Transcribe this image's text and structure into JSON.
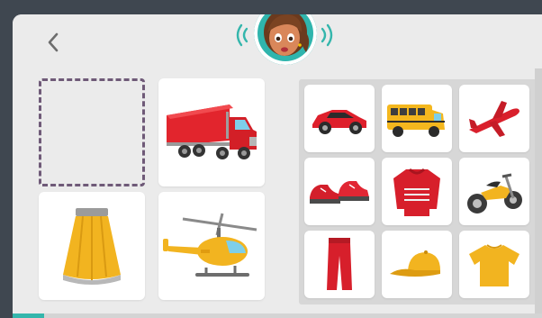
{
  "app": {
    "accent_color": "#34b6ac",
    "frame_color": "#3f4750",
    "dropzone_border_color": "#6f5a78"
  },
  "header": {
    "back_icon": "chevron-left-icon",
    "speaker_avatar_icon": "girl-avatar-icon",
    "sound_waves_icon": "sound-waves-icon"
  },
  "answer_area": {
    "dropzone_icon": "empty-dashed-slot",
    "options": [
      {
        "id": "truck",
        "icon": "red-semi-truck-icon"
      },
      {
        "id": "skirt",
        "icon": "yellow-skirt-icon"
      },
      {
        "id": "helicopter",
        "icon": "yellow-helicopter-icon"
      }
    ]
  },
  "choice_grid": {
    "items": [
      {
        "id": "car",
        "icon": "red-car-icon"
      },
      {
        "id": "bus",
        "icon": "yellow-school-bus-icon"
      },
      {
        "id": "airplane",
        "icon": "red-airplane-icon"
      },
      {
        "id": "shoes",
        "icon": "red-shoes-icon"
      },
      {
        "id": "sweater",
        "icon": "red-sweater-icon"
      },
      {
        "id": "motorcycle",
        "icon": "yellow-motorcycle-icon"
      },
      {
        "id": "pants",
        "icon": "red-pants-icon"
      },
      {
        "id": "cap",
        "icon": "yellow-cap-icon"
      },
      {
        "id": "tshirt",
        "icon": "yellow-tshirt-icon"
      }
    ]
  },
  "progress": {
    "fraction": 0.06
  }
}
